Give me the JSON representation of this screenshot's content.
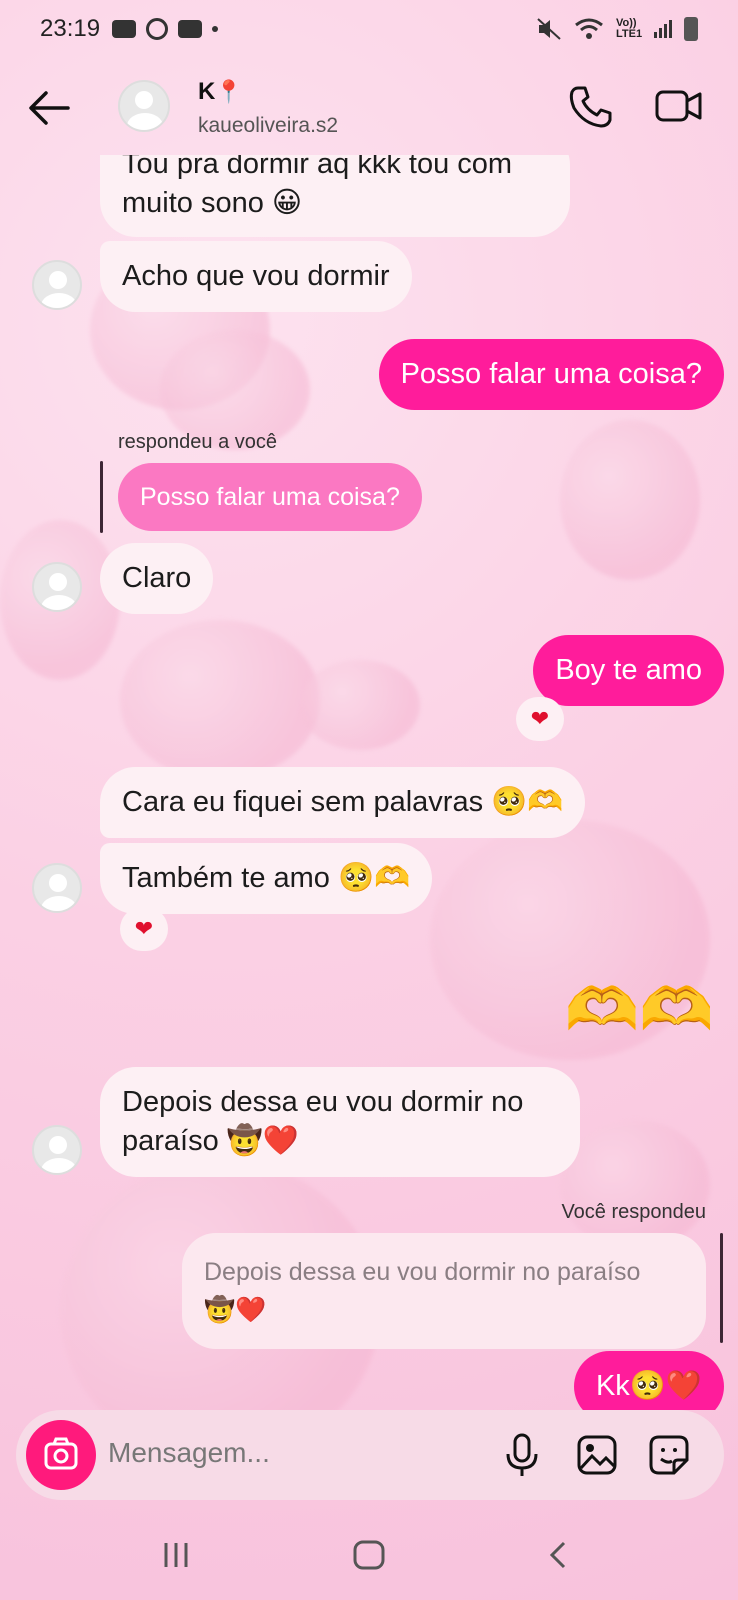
{
  "status_bar": {
    "time": "23:19",
    "network_label": "Vo)) LTE1"
  },
  "header": {
    "contact_name": "K",
    "contact_name_emoji": "📍",
    "username": "kaueoliveira.s2"
  },
  "messages": [
    {
      "side": "in",
      "lines": [
        "Tou pra dormir aq kkk tou com",
        "muito sono 😀"
      ]
    },
    {
      "side": "in",
      "lines": [
        "Acho que vou dormir"
      ]
    },
    {
      "side": "out",
      "lines": [
        "Posso falar uma coisa?"
      ]
    },
    {
      "side": "in",
      "reply_label": "respondeu a você",
      "quoted": "Posso falar uma coisa?",
      "lines": [
        "Claro"
      ]
    },
    {
      "side": "out",
      "lines": [
        "Boy te amo"
      ],
      "reaction": "❤"
    },
    {
      "side": "in",
      "lines": [
        "Cara eu fiquei sem palavras 🥺🫶"
      ]
    },
    {
      "side": "in",
      "lines": [
        "Também te amo 🥺🫶"
      ],
      "reaction": "❤"
    },
    {
      "side": "out",
      "lines": [
        "🫶🫶"
      ]
    },
    {
      "side": "in",
      "lines": [
        "Depois dessa eu vou dormir no",
        "paraíso 🤠❤️"
      ]
    },
    {
      "side": "out",
      "reply_label": "Você respondeu",
      "quoted_lines": [
        "Depois dessa eu vou dormir no paraíso",
        "🤠❤️"
      ],
      "lines": [
        "Kk🥺❤️"
      ]
    }
  ],
  "composer": {
    "placeholder": "Mensagem..."
  },
  "icons": {
    "back": "arrow-left-icon",
    "call": "phone-icon",
    "video": "video-camera-icon",
    "camera": "camera-icon",
    "mic": "microphone-icon",
    "gallery": "image-icon",
    "sticker": "sticker-icon"
  },
  "colors": {
    "outgoing_bubble": "#ff1c9b",
    "incoming_bubble": "#fdf0f4",
    "quoted_outgoing": "#fb78c2",
    "camera_button": "#ff1a7c",
    "background": "#fbd3e6"
  }
}
